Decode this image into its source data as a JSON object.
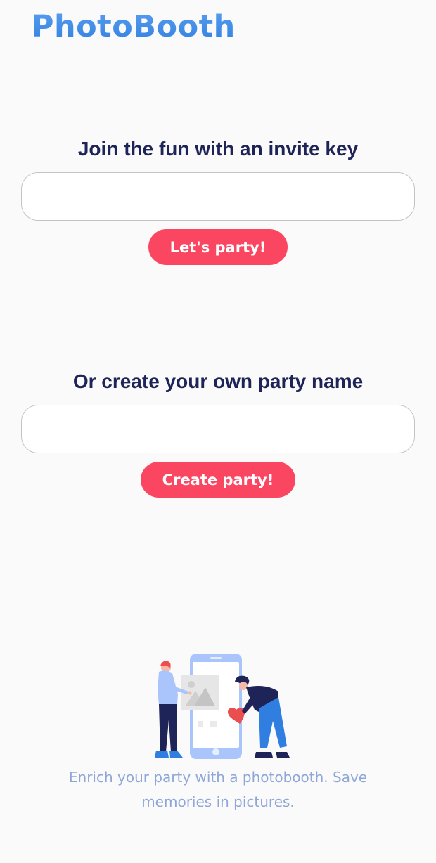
{
  "app": {
    "title": "PhotoBooth"
  },
  "join": {
    "heading": "Join the fun with an invite key",
    "input_value": "",
    "button_label": "Let's party!"
  },
  "create": {
    "heading": "Or create your own party name",
    "input_value": "",
    "button_label": "Create party!"
  },
  "footer": {
    "tagline": "Enrich your party with a photobooth. Save memories in pictures."
  },
  "colors": {
    "brand": "#4a8fe8",
    "accent": "#fb4661",
    "heading": "#1e2457",
    "muted": "#8fa7d8",
    "background": "#fafafa"
  },
  "icons": {
    "illustration": "photobooth-illustration"
  }
}
